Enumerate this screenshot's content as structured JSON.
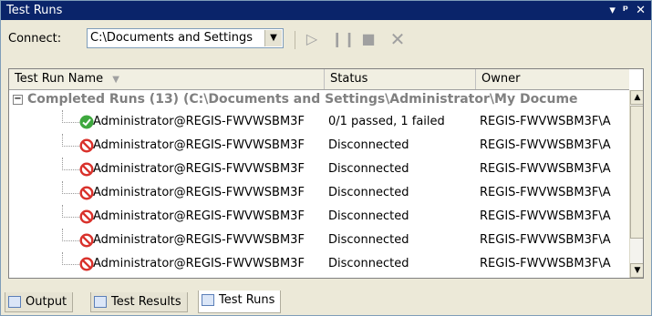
{
  "window": {
    "title": "Test Runs",
    "controls": [
      "▾",
      "ᵖ",
      "✕"
    ]
  },
  "toolbar": {
    "connect_label": "Connect:",
    "connection_value": "C:\\Documents and Settings",
    "buttons": [
      "run-icon",
      "pause-icon",
      "stop-icon",
      "delete-icon"
    ]
  },
  "grid": {
    "columns": [
      "Test Run Name",
      "Status",
      "Owner"
    ],
    "group_label": "Completed Runs (13) (C:\\Documents and Settings\\Administrator\\My Docume",
    "rows": [
      {
        "name": "Administrator@REGIS-FWVWSBM3F",
        "status": "0/1 passed, 1 failed",
        "owner": "REGIS-FWVWSBM3F\\A",
        "icon": "passed-icon"
      },
      {
        "name": "Administrator@REGIS-FWVWSBM3F",
        "status": "Disconnected",
        "owner": "REGIS-FWVWSBM3F\\A",
        "icon": "disconnected-icon"
      },
      {
        "name": "Administrator@REGIS-FWVWSBM3F",
        "status": "Disconnected",
        "owner": "REGIS-FWVWSBM3F\\A",
        "icon": "disconnected-icon"
      },
      {
        "name": "Administrator@REGIS-FWVWSBM3F",
        "status": "Disconnected",
        "owner": "REGIS-FWVWSBM3F\\A",
        "icon": "disconnected-icon"
      },
      {
        "name": "Administrator@REGIS-FWVWSBM3F",
        "status": "Disconnected",
        "owner": "REGIS-FWVWSBM3F\\A",
        "icon": "disconnected-icon"
      },
      {
        "name": "Administrator@REGIS-FWVWSBM3F",
        "status": "Disconnected",
        "owner": "REGIS-FWVWSBM3F\\A",
        "icon": "disconnected-icon"
      },
      {
        "name": "Administrator@REGIS-FWVWSBM3F",
        "status": "Disconnected",
        "owner": "REGIS-FWVWSBM3F\\A",
        "icon": "disconnected-icon"
      }
    ]
  },
  "tabs": [
    {
      "label": "Output",
      "icon": "output-icon"
    },
    {
      "label": "Test Results",
      "icon": "test-results-icon"
    },
    {
      "label": "Test Runs",
      "icon": "test-runs-icon",
      "active": true
    }
  ]
}
